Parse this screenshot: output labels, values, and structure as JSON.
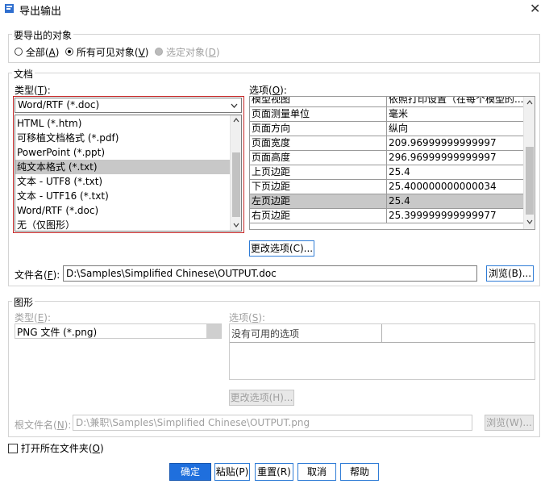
{
  "window": {
    "title": "导出输出",
    "close_glyph": "✕"
  },
  "export_objects": {
    "legend": "要导出的对象",
    "options": [
      {
        "label": "全部(",
        "key": "A",
        "suffix": ")",
        "selected": false,
        "disabled": false
      },
      {
        "label": "所有可见对象(",
        "key": "V",
        "suffix": ")",
        "selected": true,
        "disabled": false
      },
      {
        "label": "选定对象(",
        "key": "D",
        "suffix": ")",
        "selected": false,
        "disabled": true
      }
    ]
  },
  "document": {
    "legend": "文档",
    "type_label": "类型(",
    "type_key": "T",
    "type_suffix": "):",
    "type_value": "Word/RTF (*.doc)",
    "type_options": [
      "HTML (*.htm)",
      "可移植文档格式 (*.pdf)",
      "PowerPoint (*.ppt)",
      "纯文本格式 (*.txt)",
      "文本 - UTF8 (*.txt)",
      "文本 - UTF16 (*.txt)",
      "Word/RTF (*.doc)",
      "无（仅图形）"
    ],
    "type_selected_index": 3,
    "options_label": "选项(",
    "options_key": "O",
    "options_suffix": "):",
    "options_rows": [
      [
        "模型视图",
        "依照打印设置（在每个模型的..."
      ],
      [
        "页面测量单位",
        "毫米"
      ],
      [
        "页面方向",
        "纵向"
      ],
      [
        "页面宽度",
        "209.96999999999997"
      ],
      [
        "页面高度",
        "296.96999999999997"
      ],
      [
        "上页边距",
        "25.4"
      ],
      [
        "下页边距",
        "25.400000000000034"
      ],
      [
        "左页边距",
        "25.4"
      ],
      [
        "右页边距",
        "25.399999999999977"
      ]
    ],
    "options_selected_index": 7,
    "change_options_button": "更改选项(C)...",
    "file_name_label": "文件名(",
    "file_name_key": "F",
    "file_name_suffix": "):",
    "file_name_value": "D:\\Samples\\Simplified Chinese\\OUTPUT.doc",
    "browse_button": "浏览(B)..."
  },
  "graphics": {
    "legend": "图形",
    "type_label": "类型(",
    "type_key": "E",
    "type_suffix": "):",
    "type_value": "PNG 文件 (*.png)",
    "options_label": "选项(",
    "options_key": "S",
    "options_suffix": "):",
    "options_empty_text": "没有可用的选项",
    "change_options_button": "更改选项(H)...",
    "root_file_label": "根文件名(",
    "root_file_key": "N",
    "root_file_suffix": "):",
    "root_file_value": "D:\\兼职\\Samples\\Simplified Chinese\\OUTPUT.png",
    "browse_button": "浏览(W)..."
  },
  "open_folder": {
    "label": "打开所在文件夹(",
    "key": "O",
    "suffix": ")",
    "checked": false
  },
  "buttons": {
    "ok": "确定",
    "paste": "粘贴(P)",
    "reset": "重置(R)",
    "cancel": "取消",
    "help": "帮助"
  },
  "colors": {
    "accent": "#1f6fdd",
    "highlight_border": "#c62828",
    "selection": "#c8c8c8"
  },
  "icons": {
    "app": "export-window-icon",
    "close": "close-icon",
    "dropdown": "chevron-down-icon",
    "scroll_up": "scroll-up-arrow-icon",
    "scroll_down": "scroll-down-arrow-icon"
  }
}
